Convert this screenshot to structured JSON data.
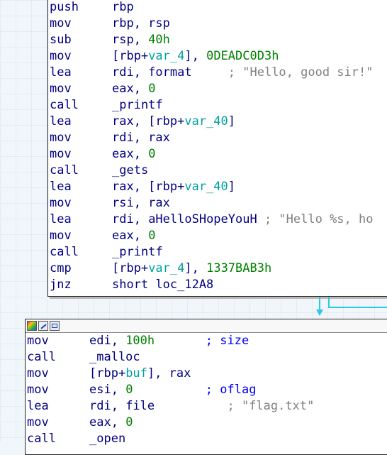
{
  "block1": {
    "lines": [
      {
        "mnemonic": "push",
        "operands": [
          {
            "t": "rbp",
            "c": "op"
          }
        ]
      },
      {
        "mnemonic": "mov",
        "operands": [
          {
            "t": "rbp, rsp",
            "c": "op"
          }
        ]
      },
      {
        "mnemonic": "sub",
        "operands": [
          {
            "t": "rsp, ",
            "c": "op"
          },
          {
            "t": "40h",
            "c": "num"
          }
        ]
      },
      {
        "mnemonic": "mov",
        "operands": [
          {
            "t": "[rbp+",
            "c": "op"
          },
          {
            "t": "var_4",
            "c": "var"
          },
          {
            "t": "], ",
            "c": "op"
          },
          {
            "t": "0DEADC0D3h",
            "c": "num"
          }
        ]
      },
      {
        "mnemonic": "lea",
        "operands": [
          {
            "t": "rdi, ",
            "c": "op"
          },
          {
            "t": "format",
            "c": "fn"
          },
          {
            "t": "     ; \"Hello, good sir!\"",
            "c": "cmt"
          }
        ]
      },
      {
        "mnemonic": "mov",
        "operands": [
          {
            "t": "eax, ",
            "c": "op"
          },
          {
            "t": "0",
            "c": "num"
          }
        ]
      },
      {
        "mnemonic": "call",
        "operands": [
          {
            "t": "_printf",
            "c": "fn"
          }
        ]
      },
      {
        "mnemonic": "lea",
        "operands": [
          {
            "t": "rax, [rbp+",
            "c": "op"
          },
          {
            "t": "var_40",
            "c": "var"
          },
          {
            "t": "]",
            "c": "op"
          }
        ]
      },
      {
        "mnemonic": "mov",
        "operands": [
          {
            "t": "rdi, rax",
            "c": "op"
          }
        ]
      },
      {
        "mnemonic": "mov",
        "operands": [
          {
            "t": "eax, ",
            "c": "op"
          },
          {
            "t": "0",
            "c": "num"
          }
        ]
      },
      {
        "mnemonic": "call",
        "operands": [
          {
            "t": "_gets",
            "c": "fn"
          }
        ]
      },
      {
        "mnemonic": "lea",
        "operands": [
          {
            "t": "rax, [rbp+",
            "c": "op"
          },
          {
            "t": "var_40",
            "c": "var"
          },
          {
            "t": "]",
            "c": "op"
          }
        ]
      },
      {
        "mnemonic": "mov",
        "operands": [
          {
            "t": "rsi, rax",
            "c": "op"
          }
        ]
      },
      {
        "mnemonic": "lea",
        "operands": [
          {
            "t": "rdi, ",
            "c": "op"
          },
          {
            "t": "aHelloSHopeYouH",
            "c": "fn"
          },
          {
            "t": " ; \"Hello %s, ho",
            "c": "cmt"
          }
        ]
      },
      {
        "mnemonic": "mov",
        "operands": [
          {
            "t": "eax, ",
            "c": "op"
          },
          {
            "t": "0",
            "c": "num"
          }
        ]
      },
      {
        "mnemonic": "call",
        "operands": [
          {
            "t": "_printf",
            "c": "fn"
          }
        ]
      },
      {
        "mnemonic": "cmp",
        "operands": [
          {
            "t": "[rbp+",
            "c": "op"
          },
          {
            "t": "var_4",
            "c": "var"
          },
          {
            "t": "], ",
            "c": "op"
          },
          {
            "t": "1337BAB3h",
            "c": "num"
          }
        ]
      },
      {
        "mnemonic": "jnz",
        "operands": [
          {
            "t": "short loc_12A8",
            "c": "op"
          }
        ]
      }
    ]
  },
  "block2": {
    "lines": [
      {
        "mnemonic": "mov",
        "operands": [
          {
            "t": "edi, ",
            "c": "op"
          },
          {
            "t": "100h",
            "c": "num"
          },
          {
            "t": "       ; size",
            "c": "cmt-blue"
          }
        ]
      },
      {
        "mnemonic": "call",
        "operands": [
          {
            "t": "_malloc",
            "c": "fn"
          }
        ]
      },
      {
        "mnemonic": "mov",
        "operands": [
          {
            "t": "[rbp+",
            "c": "op"
          },
          {
            "t": "buf",
            "c": "var"
          },
          {
            "t": "], rax",
            "c": "op"
          }
        ]
      },
      {
        "mnemonic": "mov",
        "operands": [
          {
            "t": "esi, ",
            "c": "op"
          },
          {
            "t": "0",
            "c": "num"
          },
          {
            "t": "          ; oflag",
            "c": "cmt-blue"
          }
        ]
      },
      {
        "mnemonic": "lea",
        "operands": [
          {
            "t": "rdi, ",
            "c": "op"
          },
          {
            "t": "file",
            "c": "fn"
          },
          {
            "t": "          ; \"flag.txt\"",
            "c": "cmt"
          }
        ]
      },
      {
        "mnemonic": "mov",
        "operands": [
          {
            "t": "eax, ",
            "c": "op"
          },
          {
            "t": "0",
            "c": "num"
          }
        ]
      },
      {
        "mnemonic": "call",
        "operands": [
          {
            "t": "_open",
            "c": "fn"
          }
        ]
      }
    ]
  },
  "colors": {
    "mnemonic": "#000080",
    "number": "#008000",
    "variable": "#00a0a0",
    "comment": "#808080",
    "edge": "#30c8e8"
  },
  "icons": [
    "colors-icon",
    "edit-icon",
    "graph-icon"
  ]
}
